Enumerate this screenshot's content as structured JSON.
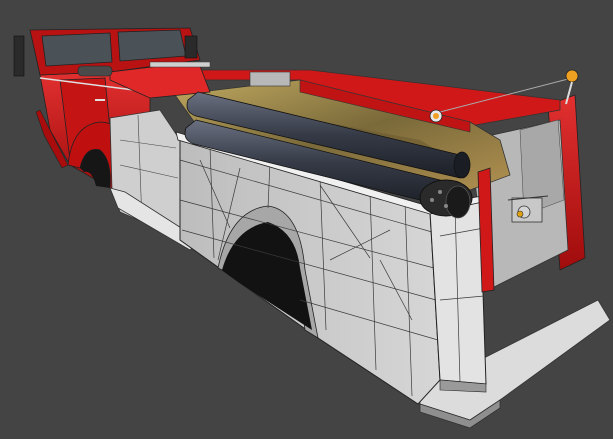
{
  "viewport": {
    "background": "#444444",
    "subject": "fire-engine-3d-model",
    "render_mode": "shaded-with-wireframe"
  },
  "colors": {
    "body_red": "#cc1010",
    "body_red_dark": "#8e0a0a",
    "body_red_light": "#e03030",
    "panel_grey": "#c9c9c9",
    "panel_grey_dark": "#9e9e9e",
    "panel_white": "#e6e6e6",
    "wire": "#333333",
    "hose_tube": "#3a3f4c",
    "hose_bed": "#a89050",
    "glass": "#4a5258",
    "chrome": "#d8d8d8",
    "lamp_amber": "#f0a020"
  }
}
